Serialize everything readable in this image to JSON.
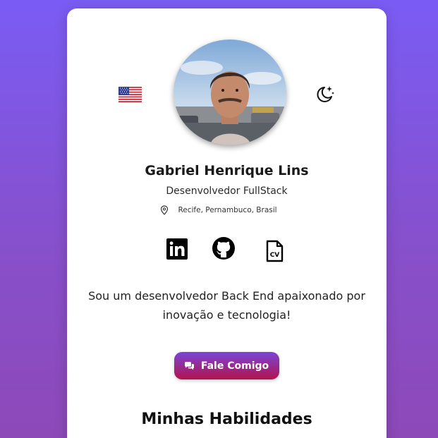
{
  "profile": {
    "name": "Gabriel Henrique Lins",
    "role": "Desenvolvedor FullStack",
    "location": "Recife, Pernambuco, Brasil",
    "bio": "Sou um desenvolvedor Back End apaixonado por inovação e tecnologia!"
  },
  "header": {
    "language_icon": "us-flag-icon",
    "theme_icon": "moon-stars-icon"
  },
  "socials": [
    {
      "icon": "linkedin-icon"
    },
    {
      "icon": "github-icon"
    },
    {
      "icon": "cv-file-icon"
    }
  ],
  "contact_button": {
    "label": "Fale Comigo",
    "icon": "chat-icon"
  },
  "skills": {
    "title": "Minhas Habilidades"
  },
  "colors": {
    "background_top": "#7a5cf4",
    "background_bottom": "#8d49b8",
    "button_top": "#7a45d8",
    "button_bottom": "#b3124c"
  }
}
